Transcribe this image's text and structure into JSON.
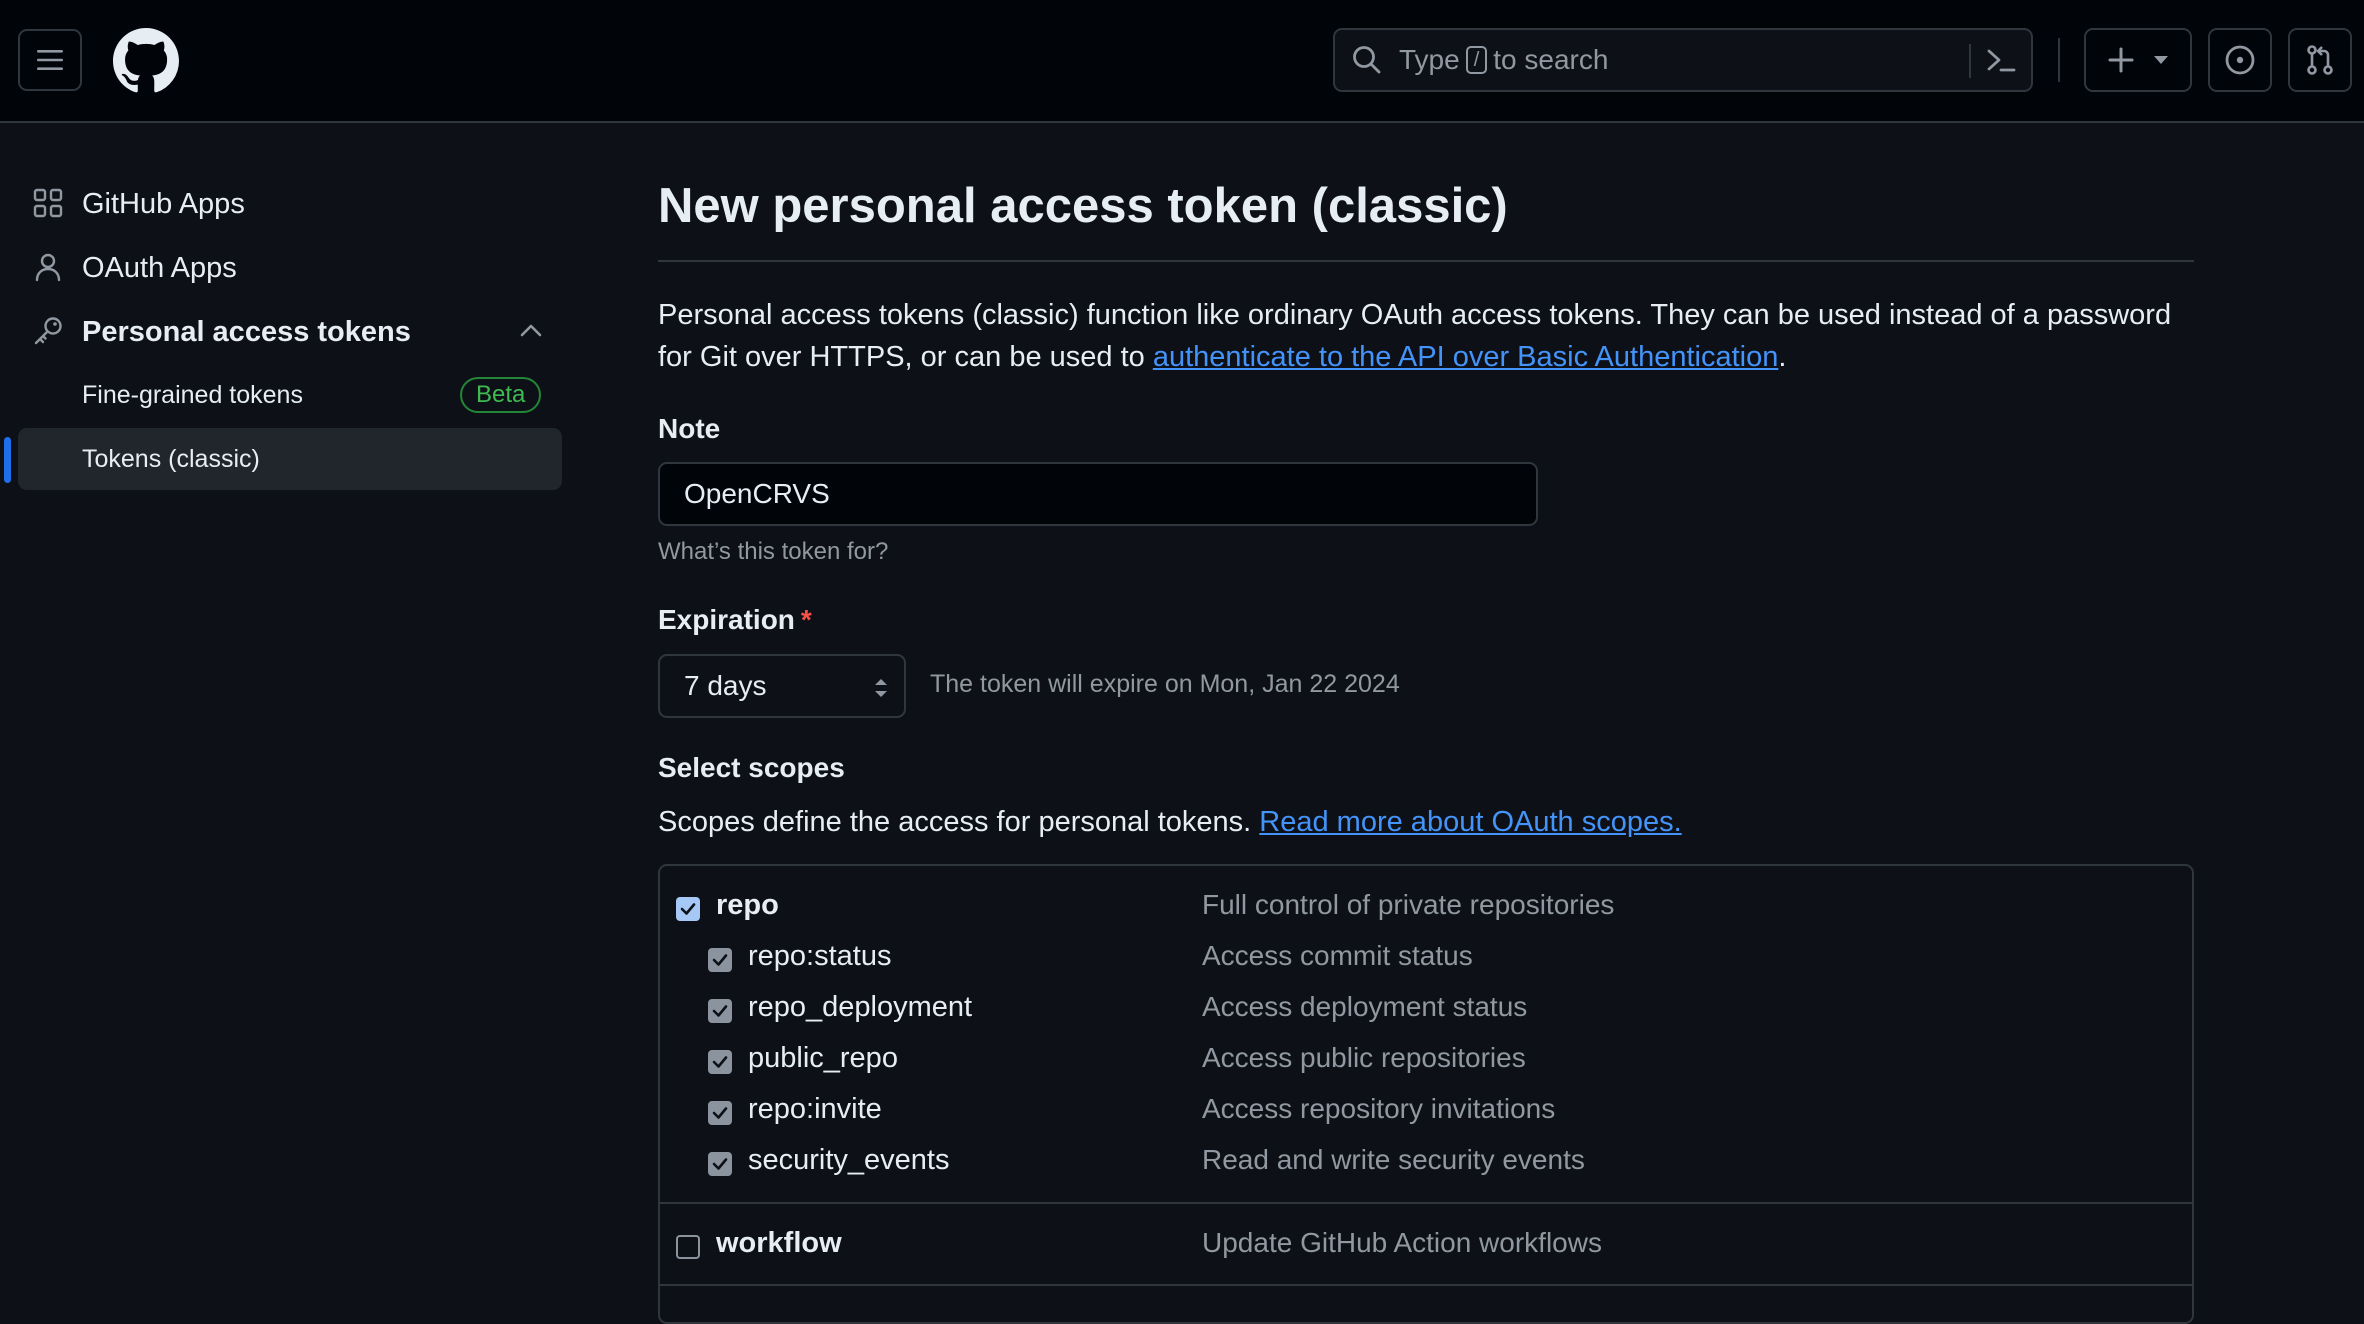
{
  "header": {
    "search_prefix": "Type",
    "search_key": "/",
    "search_suffix": "to search"
  },
  "sidebar": {
    "items": [
      {
        "label": "GitHub Apps",
        "icon": "apps-icon"
      },
      {
        "label": "OAuth Apps",
        "icon": "person-icon"
      },
      {
        "label": "Personal access tokens",
        "icon": "key-icon"
      }
    ],
    "sub_items": [
      {
        "label": "Fine-grained tokens",
        "badge": "Beta"
      },
      {
        "label": "Tokens (classic)",
        "active": true
      }
    ]
  },
  "main": {
    "title": "New personal access token (classic)",
    "intro_text": "Personal access tokens (classic) function like ordinary OAuth access tokens. They can be used instead of a password for Git over HTTPS, or can be used to ",
    "intro_link": "authenticate to the API over Basic Authentication",
    "intro_end": ".",
    "note": {
      "label": "Note",
      "value": "OpenCRVS",
      "hint": "What’s this token for?"
    },
    "expiration": {
      "label": "Expiration",
      "required_mark": "*",
      "selected": "7 days",
      "note": "The token will expire on Mon, Jan 22 2024"
    },
    "scopes": {
      "label": "Select scopes",
      "desc": "Scopes define the access for personal tokens. ",
      "link": "Read more about OAuth scopes.",
      "rows": [
        {
          "name": "repo",
          "desc": "Full control of private repositories",
          "checked": true,
          "parent": true
        },
        {
          "name": "repo:status",
          "desc": "Access commit status",
          "checked": true,
          "parent": false
        },
        {
          "name": "repo_deployment",
          "desc": "Access deployment status",
          "checked": true,
          "parent": false
        },
        {
          "name": "public_repo",
          "desc": "Access public repositories",
          "checked": true,
          "parent": false
        },
        {
          "name": "repo:invite",
          "desc": "Access repository invitations",
          "checked": true,
          "parent": false
        },
        {
          "name": "security_events",
          "desc": "Read and write security events",
          "checked": true,
          "parent": false
        },
        {
          "name": "workflow",
          "desc": "Update GitHub Action workflows",
          "checked": false,
          "parent": true
        }
      ]
    }
  },
  "colors": {
    "background": "#0d1117",
    "header_bg": "#010409",
    "border": "#30363d",
    "link": "#4493f8",
    "accent_bar": "#1f6feb",
    "badge_green": "#3fb950",
    "required_red": "#f85149"
  }
}
